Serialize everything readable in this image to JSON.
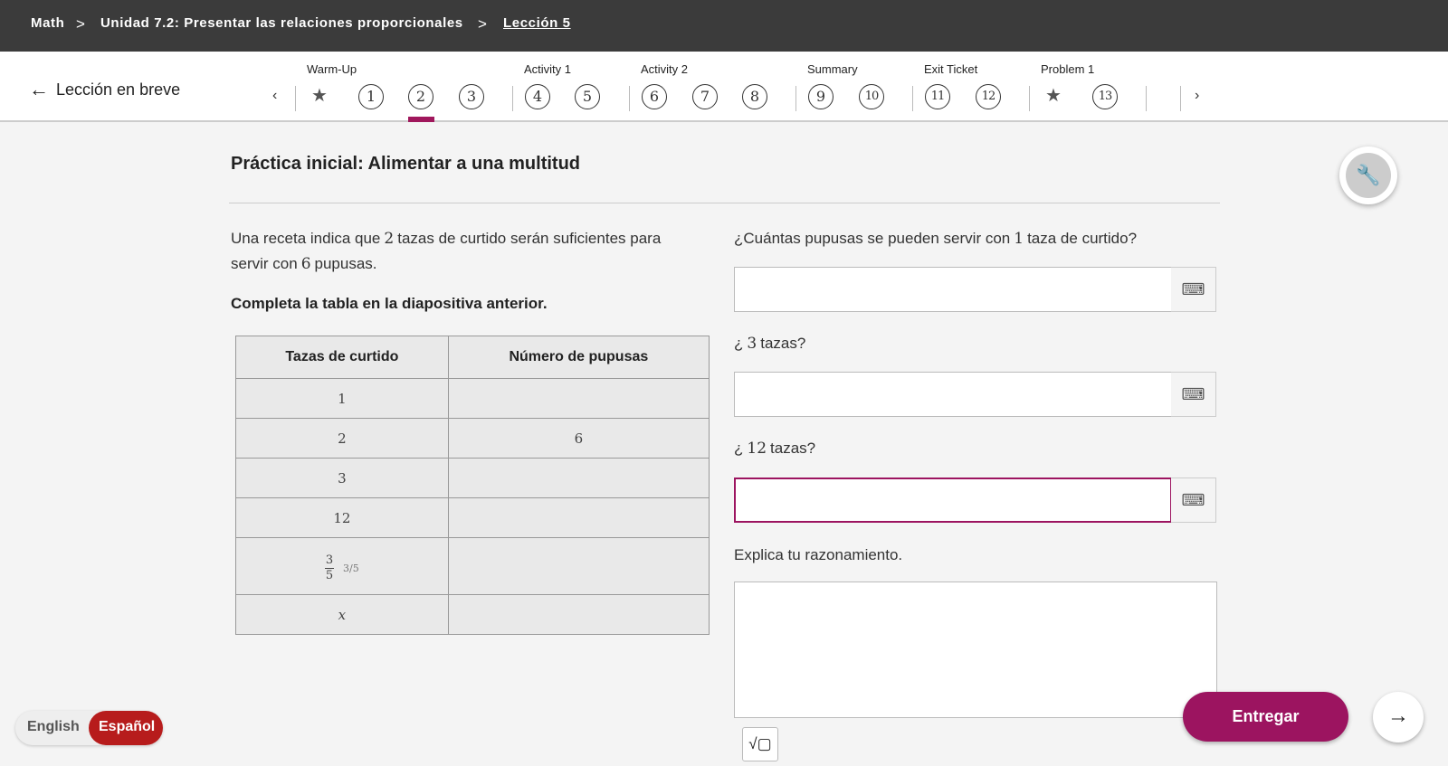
{
  "breadcrumb": {
    "items": [
      "Math",
      "Unidad 7.2: Presentar las relaciones proporcionales",
      "Lección 5"
    ]
  },
  "nav": {
    "back_label": "Lección en breve",
    "prev": "‹",
    "next": "›",
    "groups": [
      "Warm-Up",
      "Activity 1",
      "Activity 2",
      "Summary",
      "Exit Ticket",
      "Problem 1"
    ],
    "pages": [
      "1",
      "2",
      "3",
      "4",
      "5",
      "6",
      "7",
      "8",
      "9",
      "10",
      "11",
      "12",
      "13"
    ],
    "selected": "2"
  },
  "title": "Práctica inicial: Alimentar a una multitud",
  "prompt": {
    "a": "Una receta indica que",
    "n1": "2",
    "b": "tazas de curtido serán suficientes para",
    "c": "servir con",
    "n2": "6",
    "d": "pupusas."
  },
  "instruction": "Completa la tabla en la diapositiva anterior.",
  "table": {
    "headers": [
      "Tazas de curtido",
      "Número de pupusas"
    ],
    "rows": [
      [
        "1",
        ""
      ],
      [
        "2",
        "6"
      ],
      [
        "3",
        ""
      ],
      [
        "12",
        ""
      ],
      [
        "3/5",
        ""
      ],
      [
        "x",
        ""
      ]
    ],
    "frac": {
      "num": "3",
      "den": "5"
    }
  },
  "questions": [
    {
      "a": "¿Cuántas pupusas se pueden servir con",
      "n": "1",
      "b": "taza de curtido?",
      "value": ""
    },
    {
      "a": "¿",
      "n": "3",
      "b": "tazas?",
      "value": ""
    },
    {
      "a": "¿",
      "n": "12",
      "b": "tazas?",
      "value": ""
    }
  ],
  "explain_label": "Explica tu razonamiento.",
  "explain_value": "",
  "lang": {
    "en": "English",
    "es": "Español"
  },
  "submit_label": "Entregar",
  "colors": {
    "accent": "#9c1460",
    "lang_active": "#b71c1c",
    "topbar": "#3b3b3b"
  }
}
